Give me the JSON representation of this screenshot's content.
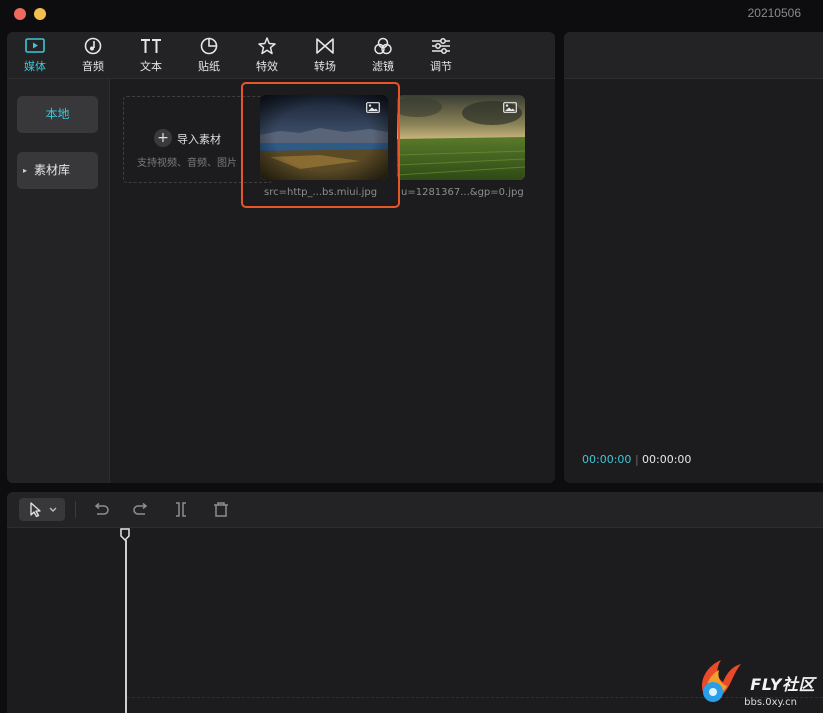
{
  "window": {
    "title": "20210506",
    "traffic_lights": [
      {
        "name": "close",
        "color": "#ed6a5e"
      },
      {
        "name": "minimize",
        "color": "#f5bf4f"
      }
    ]
  },
  "media_toolbar": {
    "tabs": [
      {
        "label": "媒体",
        "icon": "media-play-icon",
        "active": true
      },
      {
        "label": "音频",
        "icon": "audio-note-icon",
        "active": false
      },
      {
        "label": "文本",
        "icon": "text-tt-icon",
        "active": false
      },
      {
        "label": "贴纸",
        "icon": "sticker-icon",
        "active": false
      },
      {
        "label": "特效",
        "icon": "effects-star-icon",
        "active": false
      },
      {
        "label": "转场",
        "icon": "transition-bowtie-icon",
        "active": false
      },
      {
        "label": "滤镜",
        "icon": "filter-circles-icon",
        "active": false
      },
      {
        "label": "调节",
        "icon": "adjust-sliders-icon",
        "active": false
      }
    ]
  },
  "sidebar": {
    "items": [
      {
        "label": "本地",
        "active": true
      },
      {
        "label": "素材库",
        "active": false,
        "collapsed": true
      }
    ]
  },
  "import": {
    "label": "导入素材",
    "hint": "支持视频、音频、图片"
  },
  "media_items": [
    {
      "filename": "src=http_...bs.miui.jpg",
      "type_icon": "image-icon",
      "selected": true
    },
    {
      "filename": "u=1281367...&gp=0.jpg",
      "type_icon": "image-icon",
      "selected": false
    }
  ],
  "preview": {
    "current_time": "00:00:00",
    "total_time": "00:00:00"
  },
  "timeline_toolbar": {
    "tools": [
      "select-pointer-icon",
      "undo-icon",
      "redo-icon",
      "split-icon",
      "delete-icon"
    ]
  },
  "watermark": {
    "brand": "FLY社区",
    "url": "bbs.0xy.cn"
  },
  "colors": {
    "accent": "#3dc6d6",
    "selection": "#e8552b",
    "panel_bg": "#1c1c1e",
    "app_bg": "#0d0d0f"
  }
}
